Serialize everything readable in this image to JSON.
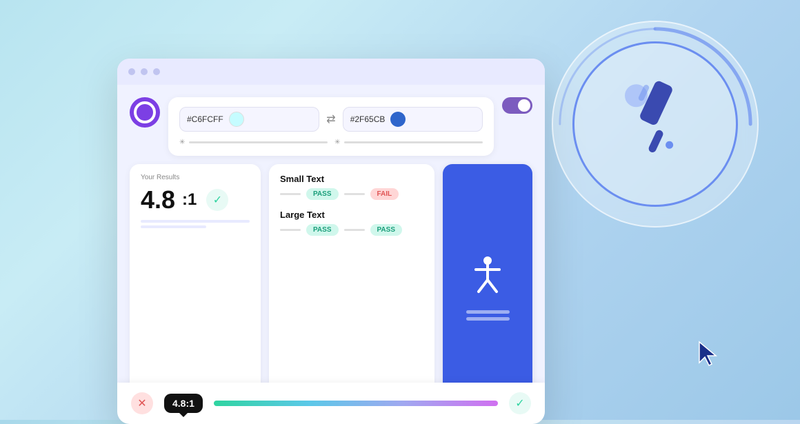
{
  "browser": {
    "dots": [
      "dot1",
      "dot2",
      "dot3"
    ],
    "titlebar_bg": "#e8eaff"
  },
  "color_picker": {
    "color1_hex": "#C6FCFF",
    "color1_swatch": "#C6FCFF",
    "color2_hex": "#2F65CB",
    "color2_swatch": "#2F65CB",
    "swap_label": "⇄"
  },
  "toggle": {
    "active": true
  },
  "results": {
    "label": "Your Results",
    "ratio": "4.8",
    "colon": ":1",
    "check": "✓"
  },
  "text_check": {
    "small_text_label": "Small Text",
    "small_pass": "PASS",
    "small_fail": "FAIL",
    "large_text_label": "Large Text",
    "large_pass1": "PASS",
    "large_pass2": "PASS"
  },
  "bottom_bar": {
    "ratio_display": "4.8:1"
  },
  "eyedropper": {
    "label": "eyedropper tool"
  },
  "logo": {
    "label": "Polypane logo"
  }
}
